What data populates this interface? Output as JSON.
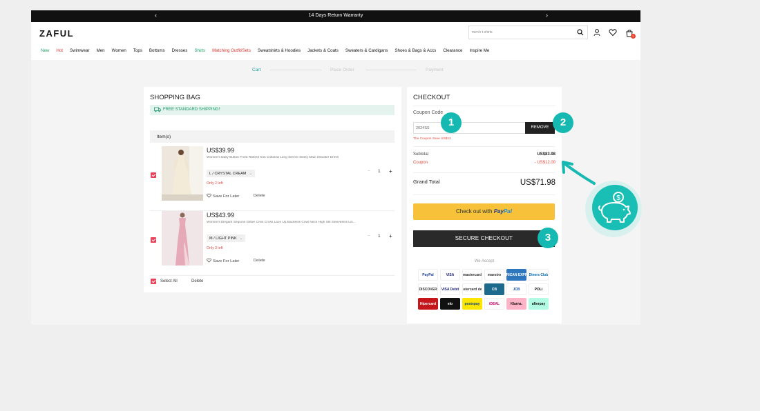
{
  "topbar": {
    "message": "14 Days Return Warranty",
    "prev": "‹",
    "next": "›"
  },
  "header": {
    "logo": "ZAFUL",
    "search_value": "men's t-shirts",
    "cart_count": "2"
  },
  "nav": [
    {
      "label": "New",
      "style": "green"
    },
    {
      "label": "Hot",
      "style": "red"
    },
    {
      "label": "Swimwear",
      "style": ""
    },
    {
      "label": "Men",
      "style": ""
    },
    {
      "label": "Women",
      "style": ""
    },
    {
      "label": "Tops",
      "style": ""
    },
    {
      "label": "Bottoms",
      "style": ""
    },
    {
      "label": "Dresses",
      "style": ""
    },
    {
      "label": "Shirts",
      "style": "green"
    },
    {
      "label": "Matching Outfit/Sets",
      "style": "red"
    },
    {
      "label": "Sweatshirts & Hoodies",
      "style": ""
    },
    {
      "label": "Jackets & Coats",
      "style": ""
    },
    {
      "label": "Sweaters & Cardigans",
      "style": ""
    },
    {
      "label": "Shoes & Bags & Accs",
      "style": ""
    },
    {
      "label": "Clearance",
      "style": ""
    },
    {
      "label": "Inspire Me",
      "style": ""
    }
  ],
  "steps": {
    "cart": "Cart",
    "place_order": "Place Order",
    "payment": "Payment"
  },
  "bag": {
    "title": "SHOPPING BAG",
    "shipping": "FREE STANDARD SHIPPING!",
    "items_header": "Item(s)",
    "items": [
      {
        "price": "US$39.99",
        "desc": "Women's Daily Button Front Ribbed Knit Collared Long Sleeve Slinky Maxi Sweater Dress",
        "variant": "L / CRYSTAL CREAM",
        "stock": "Only 2 left",
        "qty": "1",
        "save": "Save For Later",
        "delete": "Delete"
      },
      {
        "price": "US$43.99",
        "desc": "Women's Elegant Sequins Glitter Criss Cross Lace Up Backless Cowl Neck High Slit Sleeveless Lin...",
        "variant": "M / LIGHT PINK",
        "stock": "Only 3 left",
        "qty": "1",
        "save": "Save For Later",
        "delete": "Delete"
      }
    ],
    "select_all": "Select All",
    "delete_all": "Delete"
  },
  "checkout": {
    "title": "CHECKOUT",
    "coupon_label": "Coupon Code",
    "coupon_value": "2024SS",
    "remove": "REMOVE",
    "coupon_save": "The Coupon Save US$12",
    "subtotal_label": "Subtotal",
    "subtotal_value": "US$83.98",
    "coupon_row_label": "Coupon",
    "coupon_row_value": "- US$12.00",
    "grand_label": "Grand Total",
    "grand_value": "US$71.98",
    "paypal_prefix": "Check out with",
    "paypal_brand_a": "Pay",
    "paypal_brand_b": "Pal",
    "secure": "SECURE CHECKOUT",
    "we_accept": "We Accept",
    "payment_methods": [
      {
        "name": "PayPal",
        "bg": "#ffffff",
        "fg": "#1a3b8f"
      },
      {
        "name": "VISA",
        "bg": "#ffffff",
        "fg": "#1a1f71"
      },
      {
        "name": "mastercard",
        "bg": "#ffffff",
        "fg": "#333333"
      },
      {
        "name": "maestro",
        "bg": "#ffffff",
        "fg": "#333333"
      },
      {
        "name": "AMERICAN EXPRESS",
        "bg": "#2e77bc",
        "fg": "#ffffff"
      },
      {
        "name": "Diners Club",
        "bg": "#ffffff",
        "fg": "#0069aa"
      },
      {
        "name": "DISCOVER",
        "bg": "#ffffff",
        "fg": "#333333"
      },
      {
        "name": "VISA Debit",
        "bg": "#ffffff",
        "fg": "#1a1f71"
      },
      {
        "name": "mastercard debit",
        "bg": "#ffffff",
        "fg": "#333333"
      },
      {
        "name": "CB",
        "bg": "#1d6a8c",
        "fg": "#ffffff"
      },
      {
        "name": "JCB",
        "bg": "#ffffff",
        "fg": "#0b4ea2"
      },
      {
        "name": "POLi",
        "bg": "#ffffff",
        "fg": "#111111"
      },
      {
        "name": "Hipercard",
        "bg": "#c5161c",
        "fg": "#ffffff"
      },
      {
        "name": "elo",
        "bg": "#111111",
        "fg": "#ffffff"
      },
      {
        "name": "postepay",
        "bg": "#ffe600",
        "fg": "#114488"
      },
      {
        "name": "iDEAL",
        "bg": "#ffffff",
        "fg": "#cc0066"
      },
      {
        "name": "Klarna.",
        "bg": "#ffb3c7",
        "fg": "#111111"
      },
      {
        "name": "afterpay",
        "bg": "#b2fce4",
        "fg": "#111111"
      }
    ]
  },
  "callouts": {
    "one": "1",
    "two": "2",
    "three": "3"
  },
  "colors": {
    "accent": "#16b9b1",
    "sale_red": "#e0463d",
    "paypal_yellow": "#f7c13a",
    "dark": "#2a2a2a"
  }
}
